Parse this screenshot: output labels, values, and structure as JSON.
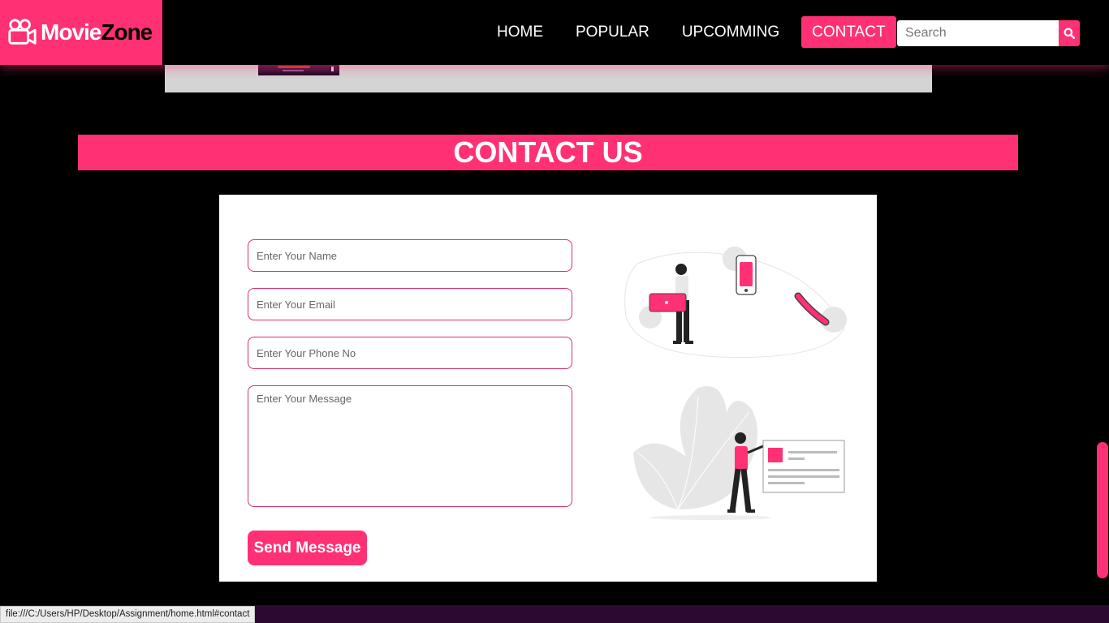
{
  "brand": {
    "movie": "Movie",
    "zone": "Zone",
    "logo_icon": "movie-camera-icon"
  },
  "nav": {
    "items": [
      {
        "label": "HOME"
      },
      {
        "label": "POPULAR"
      },
      {
        "label": "UPCOMMING"
      },
      {
        "label": "CONTACT",
        "active": true
      }
    ],
    "search_placeholder": "Search",
    "search_icon": "search-icon"
  },
  "contact": {
    "heading": "CONTACT US",
    "name_placeholder": "Enter Your Name",
    "email_placeholder": "Enter Your Email",
    "phone_placeholder": "Enter Your Phone No",
    "message_placeholder": "Enter Your Message",
    "send_label": "Send Message"
  },
  "status_url": "file:///C:/Users/HP/Desktop/Assignment/home.html#contact",
  "colors": {
    "accent": "#ff3174",
    "background": "#000000",
    "card": "#ffffff"
  }
}
